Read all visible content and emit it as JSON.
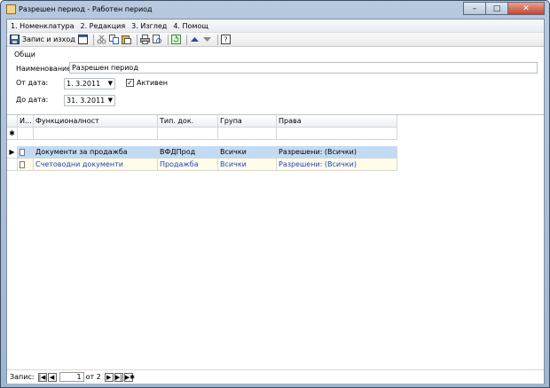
{
  "window": {
    "title": "Разрешен период - Работен период",
    "minimize_glyph": "–",
    "maximize_glyph": "□",
    "close_glyph": "✕"
  },
  "menu": [
    {
      "label": "1. Номенклатура"
    },
    {
      "label": "2. Редакция"
    },
    {
      "label": "3. Изглед"
    },
    {
      "label": "4. Помощ"
    }
  ],
  "toolbar": {
    "save_label": "Запис и изход",
    "icons": [
      "save-icon",
      "new-window-icon",
      "cut-icon",
      "copy-icon",
      "paste-icon",
      "print-icon",
      "print-preview-icon",
      "refresh-icon",
      "up-arrow-icon",
      "down-arrow-icon",
      "help-icon"
    ]
  },
  "form": {
    "group_label": "Общи",
    "name_label": "Наименование",
    "name_value": "Разрешен период",
    "from_label": "От дата:",
    "from_value": "1.  3.2011",
    "to_label": "До дата:",
    "to_value": "31.  3.2011",
    "active_label": "Активен",
    "active_checked": true
  },
  "grid": {
    "columns": [
      "И...",
      "Функционалност",
      "Тип. док.",
      "Група",
      "Права"
    ],
    "rows": [
      {
        "function": "Документи за продажба",
        "doc_type": "ВФДПрод",
        "group": "Всички",
        "rights": "Разрешени: (Всички)",
        "selected": true
      },
      {
        "function": "Счетоводни документи",
        "doc_type": "Продажба",
        "group": "Всички",
        "rights": "Разрешени: (Всички)",
        "selected": false
      }
    ],
    "new_row_marker": "✱",
    "current_row_marker": "▶"
  },
  "status": {
    "record_label": "Запис:",
    "current": "1",
    "of_label": "от 2"
  },
  "colors": {
    "selected_row": "#c3daf5",
    "alt_row": "#fffde9",
    "alt_text": "#1a3fd0",
    "title_bar": "#b6c9de"
  }
}
